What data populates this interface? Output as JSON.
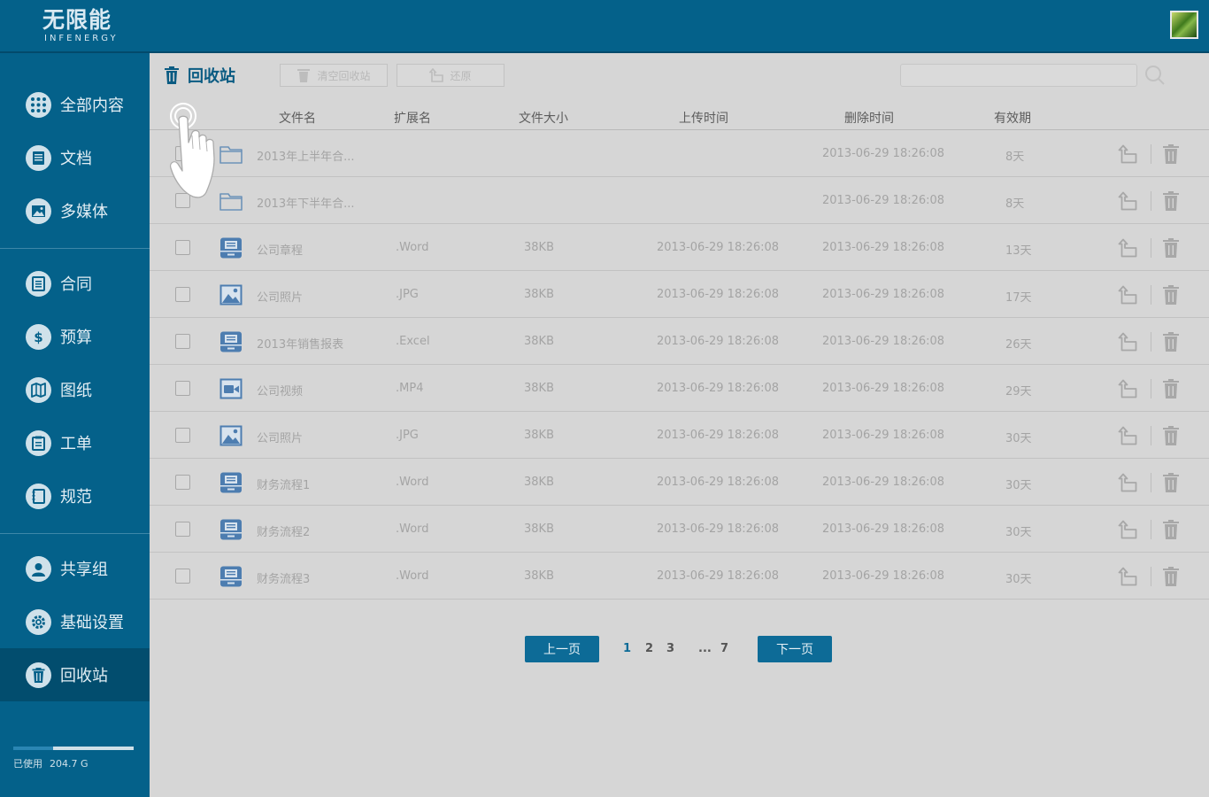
{
  "app": {
    "logo_cn": "无限能",
    "logo_en": "INFENERGY"
  },
  "colors": {
    "brand": "#04618a",
    "accent": "#0d6b97",
    "sidebar_active": "#024d6e"
  },
  "sidebar": {
    "items": [
      {
        "label": "全部内容",
        "icon": "grid-icon"
      },
      {
        "label": "文档",
        "icon": "document-icon"
      },
      {
        "label": "多媒体",
        "icon": "image-icon"
      },
      {
        "label": "合同",
        "icon": "contract-icon"
      },
      {
        "label": "预算",
        "icon": "dollar-icon"
      },
      {
        "label": "图纸",
        "icon": "map-icon"
      },
      {
        "label": "工单",
        "icon": "clipboard-icon"
      },
      {
        "label": "规范",
        "icon": "book-icon"
      },
      {
        "label": "共享组",
        "icon": "user-group-icon"
      },
      {
        "label": "基础设置",
        "icon": "gear-icon"
      },
      {
        "label": "回收站",
        "icon": "trash-icon"
      }
    ],
    "active": "回收站",
    "usage_label": "已使用",
    "usage_value": "204.7 G",
    "usage_fraction": 0.33
  },
  "toolbar": {
    "title": "回收站",
    "empty_label": "清空回收站",
    "restore_label": "还原",
    "search_value": ""
  },
  "table": {
    "headers": [
      "文件名",
      "扩展名",
      "文件大小",
      "上传时间",
      "删除时间",
      "有效期"
    ],
    "rows": [
      {
        "type": "folder",
        "icon": "folder-icon",
        "name": "2013年上半年合...",
        "ext": "",
        "size": "",
        "uploaded": "",
        "deleted": "2013-06-29  18:26:08",
        "validity": "8天"
      },
      {
        "type": "folder",
        "icon": "folder-icon",
        "name": "2013年下半年合...",
        "ext": "",
        "size": "",
        "uploaded": "",
        "deleted": "2013-06-29  18:26:08",
        "validity": "8天"
      },
      {
        "type": "doc",
        "icon": "document-icon",
        "name": "公司章程",
        "ext": ".Word",
        "size": "38KB",
        "uploaded": "2013-06-29  18:26:08",
        "deleted": "2013-06-29  18:26:08",
        "validity": "13天"
      },
      {
        "type": "image",
        "icon": "image-icon",
        "name": "公司照片",
        "ext": ".JPG",
        "size": "38KB",
        "uploaded": "2013-06-29  18:26:08",
        "deleted": "2013-06-29  18:26:08",
        "validity": "17天"
      },
      {
        "type": "doc",
        "icon": "document-icon",
        "name": "2013年销售报表",
        "ext": ".Excel",
        "size": "38KB",
        "uploaded": "2013-06-29  18:26:08",
        "deleted": "2013-06-29  18:26:08",
        "validity": "26天"
      },
      {
        "type": "video",
        "icon": "video-icon",
        "name": "公司视频",
        "ext": ".MP4",
        "size": "38KB",
        "uploaded": "2013-06-29  18:26:08",
        "deleted": "2013-06-29  18:26:08",
        "validity": "29天"
      },
      {
        "type": "image",
        "icon": "image-icon",
        "name": "公司照片",
        "ext": ".JPG",
        "size": "38KB",
        "uploaded": "2013-06-29  18:26:08",
        "deleted": "2013-06-29  18:26:08",
        "validity": "30天"
      },
      {
        "type": "doc",
        "icon": "document-icon",
        "name": "财务流程1",
        "ext": ".Word",
        "size": "38KB",
        "uploaded": "2013-06-29  18:26:08",
        "deleted": "2013-06-29  18:26:08",
        "validity": "30天"
      },
      {
        "type": "doc",
        "icon": "document-icon",
        "name": "财务流程2",
        "ext": ".Word",
        "size": "38KB",
        "uploaded": "2013-06-29  18:26:08",
        "deleted": "2013-06-29  18:26:08",
        "validity": "30天"
      },
      {
        "type": "doc",
        "icon": "document-icon",
        "name": "财务流程3",
        "ext": ".Word",
        "size": "38KB",
        "uploaded": "2013-06-29  18:26:08",
        "deleted": "2013-06-29  18:26:08",
        "validity": "30天"
      }
    ]
  },
  "pagination": {
    "prev_label": "上一页",
    "next_label": "下一页",
    "pages": [
      "1",
      "2",
      "3",
      "...",
      "7"
    ],
    "current": "1"
  }
}
